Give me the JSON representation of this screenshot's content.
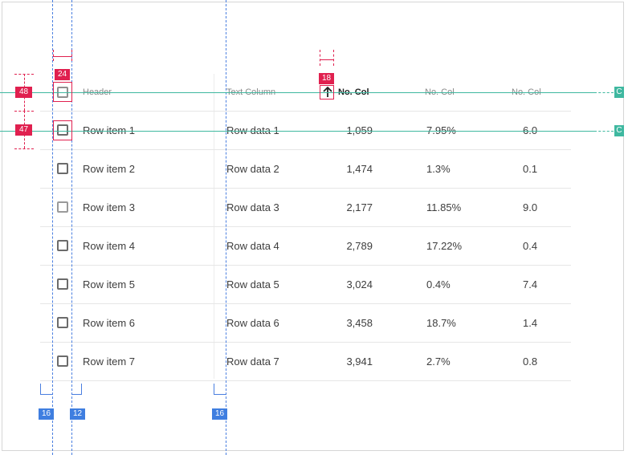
{
  "table": {
    "header": {
      "label": "Header",
      "text_column": "Text Column",
      "no_col_sorted": "No. Col",
      "no_col_2": "No. Col",
      "no_col_3": "No. Col"
    },
    "rows": [
      {
        "item": "Row item 1",
        "text": "Row data 1",
        "num": "1,059",
        "pct": "7.95%",
        "val": "6.0"
      },
      {
        "item": "Row item 2",
        "text": "Row data 2",
        "num": "1,474",
        "pct": "1.3%",
        "val": "0.1"
      },
      {
        "item": "Row item 3",
        "text": "Row data 3",
        "num": "2,177",
        "pct": "11.85%",
        "val": "9.0"
      },
      {
        "item": "Row item 4",
        "text": "Row data 4",
        "num": "2,789",
        "pct": "17.22%",
        "val": "0.4"
      },
      {
        "item": "Row item 5",
        "text": "Row data 5",
        "num": "3,024",
        "pct": "0.4%",
        "val": "7.4"
      },
      {
        "item": "Row item 6",
        "text": "Row data 6",
        "num": "3,458",
        "pct": "18.7%",
        "val": "1.4"
      },
      {
        "item": "Row item 7",
        "text": "Row data 7",
        "num": "3,941",
        "pct": "2.7%",
        "val": "0.8"
      }
    ]
  },
  "annotations": {
    "checkbox_size": "24",
    "icon_size": "18",
    "header_height": "48",
    "row_height": "47",
    "left_padding": "16",
    "checkbox_gap": "12",
    "divider_padding": "16",
    "header_baseline_tag": "C",
    "row_baseline_tag": "C"
  },
  "colors": {
    "measure_red": "#e0204f",
    "measure_blue": "#3f7ee0",
    "baseline_teal": "#3fb8a0"
  },
  "icons": {
    "sort": "arrow-up-icon"
  }
}
